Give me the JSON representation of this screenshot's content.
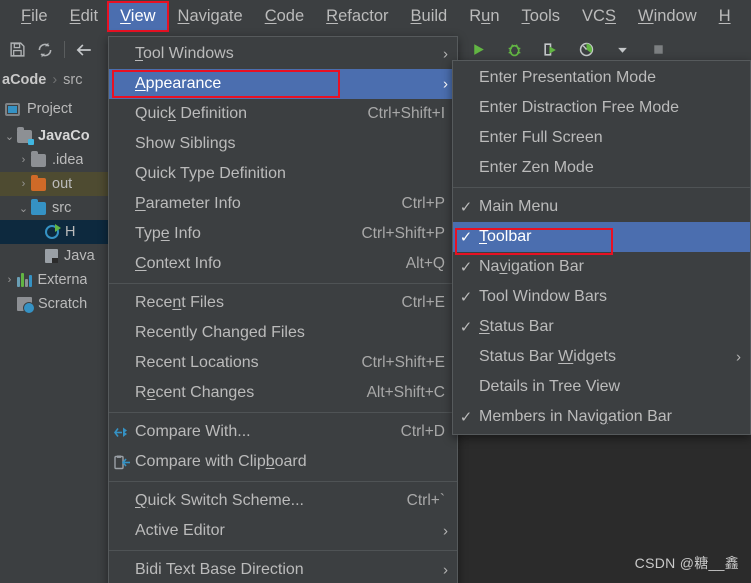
{
  "app": {
    "watermark": "CSDN @糖__鑫"
  },
  "menubar": {
    "items": [
      {
        "label": "File",
        "mnemonic": "F",
        "active": false
      },
      {
        "label": "Edit",
        "mnemonic": "E",
        "active": false
      },
      {
        "label": "View",
        "mnemonic": "V",
        "active": true
      },
      {
        "label": "Navigate",
        "mnemonic": "N",
        "active": false
      },
      {
        "label": "Code",
        "mnemonic": "C",
        "active": false
      },
      {
        "label": "Refactor",
        "mnemonic": "R",
        "active": false
      },
      {
        "label": "Build",
        "mnemonic": "B",
        "active": false
      },
      {
        "label": "Run",
        "mnemonic": "u",
        "active": false
      },
      {
        "label": "Tools",
        "mnemonic": "T",
        "active": false
      },
      {
        "label": "VCS",
        "mnemonic": "S",
        "active": false
      },
      {
        "label": "Window",
        "mnemonic": "W",
        "active": false
      },
      {
        "label": "H",
        "mnemonic": "H",
        "active": false
      }
    ]
  },
  "toolbar": {
    "icons": [
      "save-all-icon",
      "sync-icon",
      "back-arrow-icon"
    ],
    "run_icons": [
      "run-icon",
      "debug-icon",
      "run-with-coverage-icon",
      "profiler-icon",
      "dropdown-arrow-icon",
      "stop-icon"
    ]
  },
  "navbar": {
    "project": "aCode",
    "separator": "›",
    "path": "src"
  },
  "sidebar": {
    "title": "Project",
    "tree": [
      {
        "label": "JavaCo",
        "indent": 0,
        "arrow": "⌄",
        "icon": "folder-module-icon",
        "bold": true,
        "state": ""
      },
      {
        "label": ".idea",
        "indent": 1,
        "arrow": "›",
        "icon": "folder-grey-icon",
        "bold": false,
        "state": ""
      },
      {
        "label": "out",
        "indent": 1,
        "arrow": "›",
        "icon": "folder-orange-icon",
        "bold": false,
        "state": "out"
      },
      {
        "label": "src",
        "indent": 1,
        "arrow": "⌄",
        "icon": "folder-teal-icon",
        "bold": false,
        "state": ""
      },
      {
        "label": "H",
        "indent": 2,
        "arrow": "",
        "icon": "java-class-icon",
        "bold": false,
        "state": "file"
      },
      {
        "label": "Java",
        "indent": 2,
        "arrow": "",
        "icon": "jar-icon",
        "bold": false,
        "state": ""
      },
      {
        "label": "Externa",
        "indent": 0,
        "arrow": "›",
        "icon": "external-libraries-icon",
        "bold": false,
        "state": ""
      },
      {
        "label": "Scratch",
        "indent": 0,
        "arrow": "",
        "icon": "scratches-icon",
        "bold": false,
        "state": ""
      }
    ]
  },
  "view_menu": {
    "items": [
      {
        "type": "item",
        "label": "Tool Windows",
        "mnemonic": "T",
        "accel": "",
        "submenu": true,
        "highlight": false,
        "icon": ""
      },
      {
        "type": "item",
        "label": "Appearance",
        "mnemonic": "A",
        "accel": "",
        "submenu": true,
        "highlight": true,
        "icon": ""
      },
      {
        "type": "item",
        "label": "Quick Definition",
        "mnemonic": "k",
        "accel": "Ctrl+Shift+I",
        "submenu": false,
        "highlight": false,
        "icon": ""
      },
      {
        "type": "item",
        "label": "Show Siblings",
        "mnemonic": "",
        "accel": "",
        "submenu": false,
        "highlight": false,
        "icon": ""
      },
      {
        "type": "item",
        "label": "Quick Type Definition",
        "mnemonic": "",
        "accel": "",
        "submenu": false,
        "highlight": false,
        "icon": ""
      },
      {
        "type": "item",
        "label": "Parameter Info",
        "mnemonic": "P",
        "accel": "Ctrl+P",
        "submenu": false,
        "highlight": false,
        "icon": ""
      },
      {
        "type": "item",
        "label": "Type Info",
        "mnemonic": "e",
        "accel": "Ctrl+Shift+P",
        "submenu": false,
        "highlight": false,
        "icon": ""
      },
      {
        "type": "item",
        "label": "Context Info",
        "mnemonic": "C",
        "accel": "Alt+Q",
        "submenu": false,
        "highlight": false,
        "icon": ""
      },
      {
        "type": "separator"
      },
      {
        "type": "item",
        "label": "Recent Files",
        "mnemonic": "n",
        "accel": "Ctrl+E",
        "submenu": false,
        "highlight": false,
        "icon": ""
      },
      {
        "type": "item",
        "label": "Recently Changed Files",
        "mnemonic": "",
        "accel": "",
        "submenu": false,
        "highlight": false,
        "icon": ""
      },
      {
        "type": "item",
        "label": "Recent Locations",
        "mnemonic": "",
        "accel": "Ctrl+Shift+E",
        "submenu": false,
        "highlight": false,
        "icon": ""
      },
      {
        "type": "item",
        "label": "Recent Changes",
        "mnemonic": "e",
        "accel": "Alt+Shift+C",
        "submenu": false,
        "highlight": false,
        "icon": ""
      },
      {
        "type": "separator"
      },
      {
        "type": "item",
        "label": "Compare With...",
        "mnemonic": "",
        "accel": "Ctrl+D",
        "submenu": false,
        "highlight": false,
        "icon": "compare-with-icon"
      },
      {
        "type": "item",
        "label": "Compare with Clipboard",
        "mnemonic": "b",
        "accel": "",
        "submenu": false,
        "highlight": false,
        "icon": "compare-clipboard-icon"
      },
      {
        "type": "separator"
      },
      {
        "type": "item",
        "label": "Quick Switch Scheme...",
        "mnemonic": "Q",
        "accel": "Ctrl+`",
        "submenu": false,
        "highlight": false,
        "icon": ""
      },
      {
        "type": "item",
        "label": "Active Editor",
        "mnemonic": "",
        "accel": "",
        "submenu": true,
        "highlight": false,
        "icon": ""
      },
      {
        "type": "separator"
      },
      {
        "type": "item",
        "label": "Bidi Text Base Direction",
        "mnemonic": "",
        "accel": "",
        "submenu": true,
        "highlight": false,
        "icon": ""
      }
    ]
  },
  "appearance_menu": {
    "items": [
      {
        "type": "item",
        "label": "Enter Presentation Mode",
        "mnemonic": "",
        "checked": false,
        "submenu": false,
        "highlight": false
      },
      {
        "type": "item",
        "label": "Enter Distraction Free Mode",
        "mnemonic": "",
        "checked": false,
        "submenu": false,
        "highlight": false
      },
      {
        "type": "item",
        "label": "Enter Full Screen",
        "mnemonic": "",
        "checked": false,
        "submenu": false,
        "highlight": false
      },
      {
        "type": "item",
        "label": "Enter Zen Mode",
        "mnemonic": "",
        "checked": false,
        "submenu": false,
        "highlight": false
      },
      {
        "type": "separator"
      },
      {
        "type": "item",
        "label": "Main Menu",
        "mnemonic": "",
        "checked": true,
        "submenu": false,
        "highlight": false
      },
      {
        "type": "item",
        "label": "Toolbar",
        "mnemonic": "T",
        "checked": true,
        "submenu": false,
        "highlight": true
      },
      {
        "type": "item",
        "label": "Navigation Bar",
        "mnemonic": "v",
        "checked": true,
        "submenu": false,
        "highlight": false
      },
      {
        "type": "item",
        "label": "Tool Window Bars",
        "mnemonic": "",
        "checked": true,
        "submenu": false,
        "highlight": false
      },
      {
        "type": "item",
        "label": "Status Bar",
        "mnemonic": "S",
        "checked": true,
        "submenu": false,
        "highlight": false
      },
      {
        "type": "item",
        "label": "Status Bar Widgets",
        "mnemonic": "W",
        "checked": false,
        "submenu": true,
        "highlight": false
      },
      {
        "type": "item",
        "label": "Details in Tree View",
        "mnemonic": "",
        "checked": false,
        "submenu": false,
        "highlight": false
      },
      {
        "type": "item",
        "label": "Members in Navigation Bar",
        "mnemonic": "g",
        "checked": true,
        "submenu": false,
        "highlight": false
      }
    ]
  },
  "colors": {
    "highlight_blue": "#4b6eaf",
    "annotation_red": "#e81123",
    "panel_bg": "#3c3f41",
    "editor_bg": "#2b2b2b",
    "folder_orange": "#cf6a28",
    "folder_teal": "#3592c4",
    "run_green": "#62b543"
  }
}
